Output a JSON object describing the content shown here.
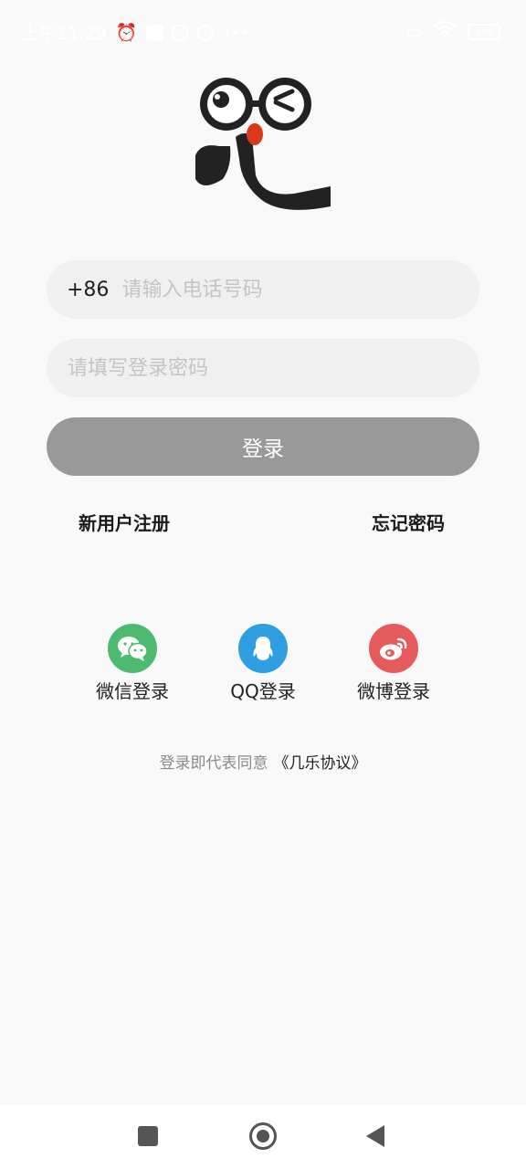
{
  "status_bar": {
    "time": "上午11:29",
    "battery": "100"
  },
  "login": {
    "country_code": "+86",
    "phone_placeholder": "请输入电话号码",
    "password_placeholder": "请填写登录密码",
    "login_label": "登录",
    "register_label": "新用户注册",
    "forgot_label": "忘记密码"
  },
  "social": {
    "wechat_label": "微信登录",
    "qq_label": "QQ登录",
    "weibo_label": "微博登录"
  },
  "agreement": {
    "prefix": "登录即代表同意",
    "doc_link": "《几乐协议》"
  },
  "colors": {
    "background": "#f9f9f9",
    "login_button": "#999999",
    "wechat": "#4eba6f",
    "qq": "#2f9ee0",
    "weibo": "#e55a5a"
  }
}
